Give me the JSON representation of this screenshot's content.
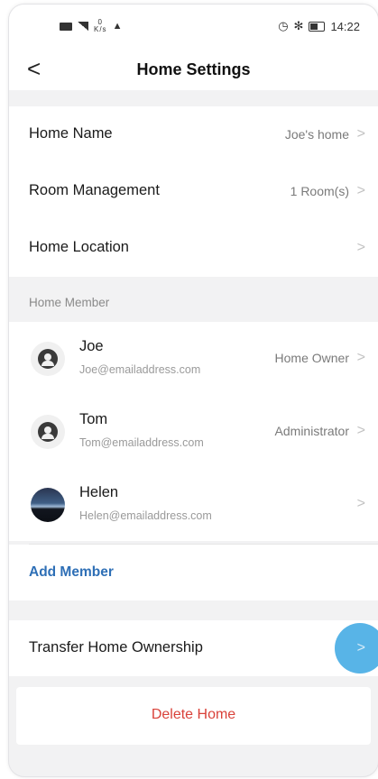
{
  "status_bar": {
    "net_speed_value": "0",
    "net_speed_unit": "K/s",
    "time": "14:22"
  },
  "header": {
    "back_glyph": "<",
    "title": "Home Settings"
  },
  "settings": {
    "home_name": {
      "label": "Home Name",
      "value": "Joe's  home"
    },
    "room_management": {
      "label": "Room Management",
      "value": "1 Room(s)"
    },
    "home_location": {
      "label": "Home Location",
      "value": ""
    }
  },
  "members_section": {
    "header": "Home Member",
    "members": [
      {
        "name": "Joe",
        "email": "Joe@emailaddress.com",
        "role": "Home Owner",
        "avatar": "default-user-avatar"
      },
      {
        "name": "Tom",
        "email": "Tom@emailaddress.com",
        "role": "Administrator",
        "avatar": "default-user-avatar"
      },
      {
        "name": "Helen",
        "email": "Helen@emailaddress.com",
        "role": "",
        "avatar": "photo-avatar"
      }
    ],
    "add_member_label": "Add Member"
  },
  "transfer": {
    "label": "Transfer Home Ownership"
  },
  "delete": {
    "label": "Delete Home"
  },
  "chevron_glyph": ">",
  "colors": {
    "accent_blue": "#2e6fb6",
    "delete_red": "#d9423a",
    "touch_indicator": "#4fb0e6",
    "background": "#f2f2f3"
  }
}
